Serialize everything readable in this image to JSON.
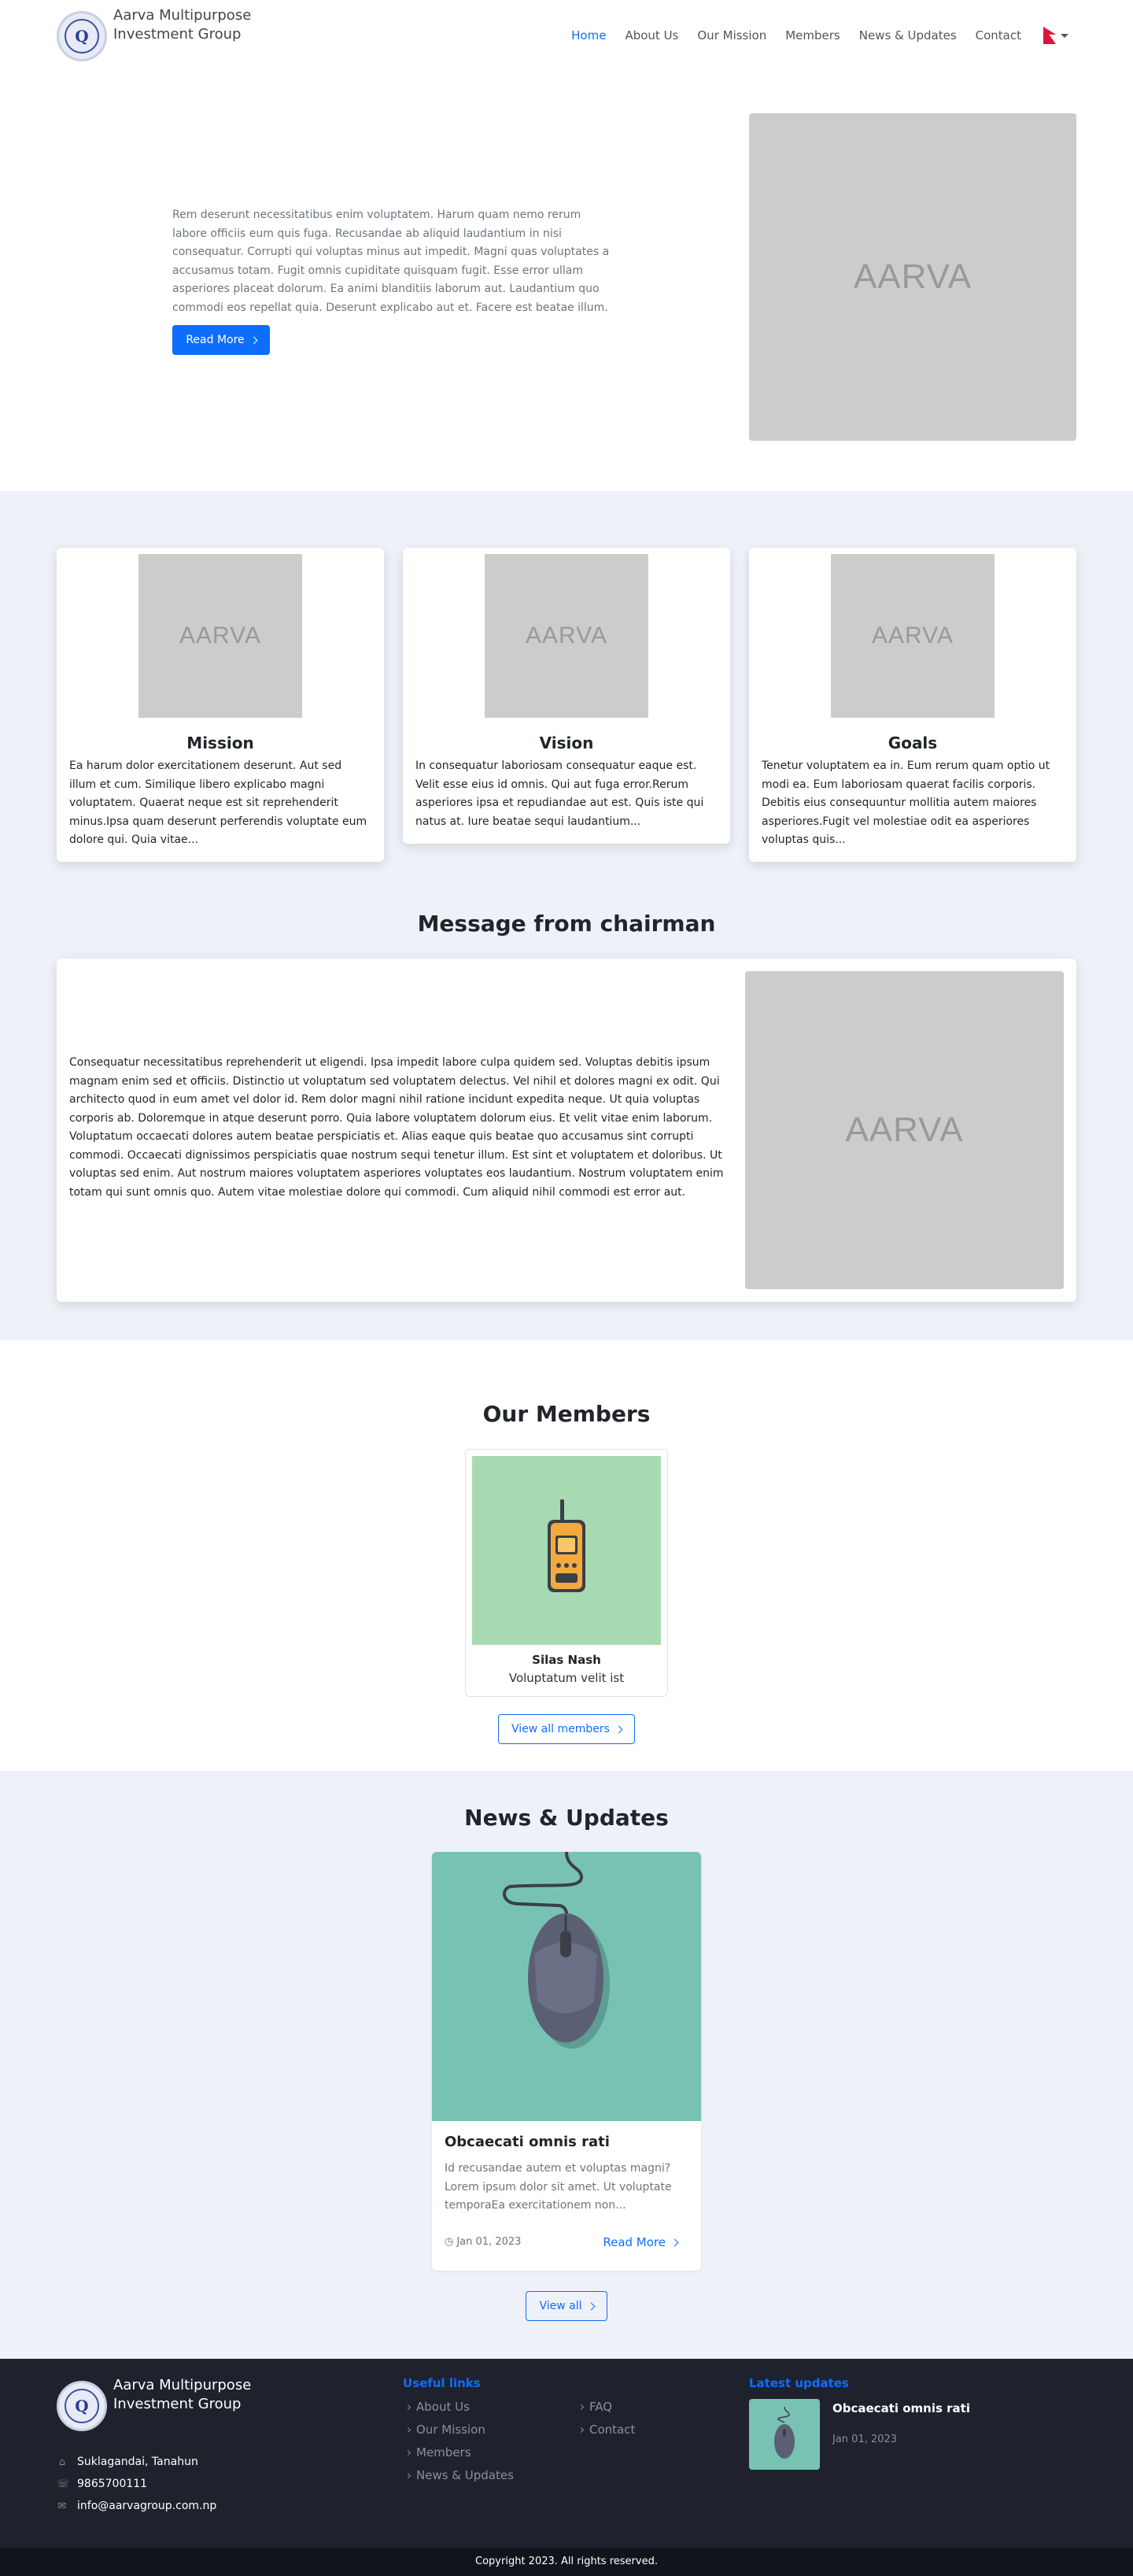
{
  "brand": {
    "name": "Aarva Multipurpose Investment Group",
    "logo_letter": "Q"
  },
  "nav": {
    "items": [
      "Home",
      "About Us",
      "Our Mission",
      "Members",
      "News & Updates",
      "Contact"
    ],
    "active": "Home"
  },
  "hero": {
    "text": "Rem deserunt necessitatibus enim voluptatem. Harum quam nemo rerum labore officiis eum quis fuga. Recusandae ab aliquid laudantium in nisi consequatur. Corrupti qui voluptas minus aut impedit. Magni quas voluptates a accusamus totam. Fugit omnis cupiditate quisquam fugit. Esse error ullam asperiores placeat dolorum. Ea animi blanditiis laborum aut. Laudantium quo commodi eos repellat quia. Deserunt explicabo aut et. Facere est beatae illum. Non omnis",
    "button": "Read More",
    "image_label": "AARVA"
  },
  "cards": [
    {
      "title": "Mission",
      "image_label": "AARVA",
      "text": "Ea harum dolor exercitationem deserunt. Aut sed illum et cum. Similique libero explicabo magni voluptatem. Quaerat neque est sit reprehenderit minus.Ipsa quam deserunt perferendis voluptate eum dolore qui. Quia vitae..."
    },
    {
      "title": "Vision",
      "image_label": "AARVA",
      "text": "In consequatur laboriosam consequatur eaque est. Velit esse eius id omnis. Qui aut fuga error.Rerum asperiores ipsa et repudiandae aut est. Quis iste qui natus at. Iure beatae sequi laudantium..."
    },
    {
      "title": "Goals",
      "image_label": "AARVA",
      "text": "Tenetur voluptatem ea in. Eum rerum quam optio ut modi ea. Eum laboriosam quaerat facilis corporis. Debitis eius consequuntur mollitia autem maiores asperiores.Fugit vel molestiae odit ea asperiores voluptas quis..."
    }
  ],
  "chairman": {
    "title": "Message from chairman",
    "text": "Consequatur necessitatibus reprehenderit ut eligendi. Ipsa impedit labore culpa quidem sed. Voluptas debitis ipsum magnam enim sed et officiis. Distinctio ut voluptatum sed voluptatem delectus. Vel nihil et dolores magni ex odit. Qui architecto quod in eum amet vel dolor id. Rem dolor magni nihil ratione incidunt expedita neque. Ut quia voluptas corporis ab. Doloremque in atque deserunt porro. Quia labore voluptatem dolorum eius. Et velit vitae enim laborum. Voluptatum occaecati dolores autem beatae perspiciatis et. Alias eaque quis beatae quo accusamus sint corrupti commodi. Occaecati dignissimos perspiciatis quae nostrum sequi tenetur illum. Est sint et voluptatem et doloribus. Ut voluptas sed enim. Aut nostrum maiores voluptatem asperiores voluptates eos laudantium. Nostrum voluptatem enim totam qui sunt omnis quo. Autem vitae molestiae dolore qui commodi. Cum aliquid nihil commodi est error aut.",
    "image_label": "AARVA"
  },
  "members": {
    "title": "Our Members",
    "items": [
      {
        "name": "Silas Nash",
        "role": "Voluptatum velit ist"
      }
    ],
    "view_all": "View all members"
  },
  "news": {
    "title": "News & Updates",
    "items": [
      {
        "title": "Obcaecati omnis rati",
        "excerpt": "Id recusandae autem et voluptas magni? Lorem ipsum dolor sit amet. Ut voluptate temporaEa exercitationem non...",
        "date": "Jan 01, 2023",
        "read_more": "Read More"
      }
    ],
    "view_all": "View all"
  },
  "footer": {
    "address": "Suklagandai, Tanahun",
    "phone": "9865700111",
    "email": "info@aarvagroup.com.np",
    "useful_links_title": "Useful links",
    "links_col1": [
      "About Us",
      "Our Mission",
      "Members",
      "News & Updates"
    ],
    "links_col2": [
      "FAQ",
      "Contact"
    ],
    "latest_title": "Latest updates",
    "latest": [
      {
        "title": "Obcaecati omnis rati",
        "date": "Jan 01, 2023"
      }
    ],
    "copyright": "Copyright 2023. All rights reserved."
  },
  "colors": {
    "primary": "#0d6efd",
    "section_bg": "#eef1f8",
    "footer_bg": "#1f222d",
    "placeholder": "#cccccc"
  }
}
